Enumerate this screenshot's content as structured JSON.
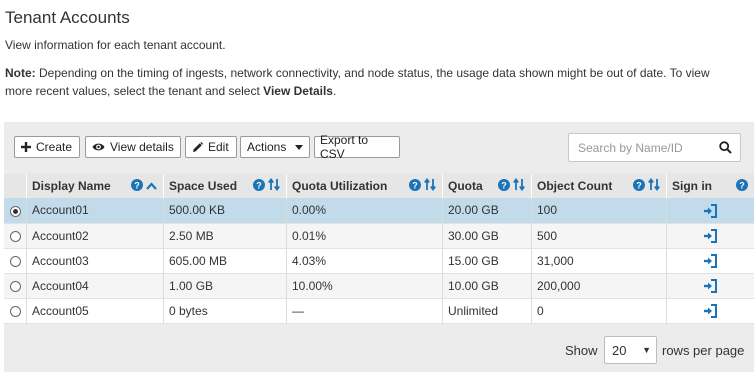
{
  "header": {
    "title": "Tenant Accounts",
    "subtitle": "View information for each tenant account.",
    "note_label": "Note:",
    "note_text": " Depending on the timing of ingests, network connectivity, and node status, the usage data shown might be out of date. To view more recent values, select the tenant and select ",
    "note_link": "View Details",
    "note_end": "."
  },
  "toolbar": {
    "create_label": "Create",
    "view_details_label": "View details",
    "edit_label": "Edit",
    "actions_label": "Actions",
    "export_label": "Export to CSV",
    "search_placeholder": "Search by Name/ID"
  },
  "table": {
    "columns": [
      "Display Name",
      "Space Used",
      "Quota Utilization",
      "Quota",
      "Object Count",
      "Sign in"
    ],
    "rows": [
      {
        "selected": true,
        "name": "Account01",
        "space_used": "500.00 KB",
        "quota_util": "0.00%",
        "quota": "20.00 GB",
        "object_count": "100"
      },
      {
        "selected": false,
        "name": "Account02",
        "space_used": "2.50 MB",
        "quota_util": "0.01%",
        "quota": "30.00 GB",
        "object_count": "500"
      },
      {
        "selected": false,
        "name": "Account03",
        "space_used": "605.00 MB",
        "quota_util": "4.03%",
        "quota": "15.00 GB",
        "object_count": "31,000"
      },
      {
        "selected": false,
        "name": "Account04",
        "space_used": "1.00 GB",
        "quota_util": "10.00%",
        "quota": "10.00 GB",
        "object_count": "200,000"
      },
      {
        "selected": false,
        "name": "Account05",
        "space_used": "0 bytes",
        "quota_util": "—",
        "quota": "Unlimited",
        "object_count": "0"
      }
    ]
  },
  "pagination": {
    "show_label": "Show",
    "rows_per_page_value": "20",
    "rows_per_page_label": "rows per page"
  },
  "colors": {
    "selected_row": "#c2dbea",
    "icon_blue": "#1b74b8",
    "header_bg": "#e6e6e6"
  },
  "icons": {
    "create": "plus-icon",
    "view": "eye-icon",
    "edit": "pencil-icon",
    "dropdown": "caret-down-icon",
    "search": "search-icon",
    "help": "help-circle-icon",
    "sort": "sort-arrows-icon",
    "sort_asc": "sort-ascending-icon",
    "sign_in": "sign-in-icon"
  }
}
